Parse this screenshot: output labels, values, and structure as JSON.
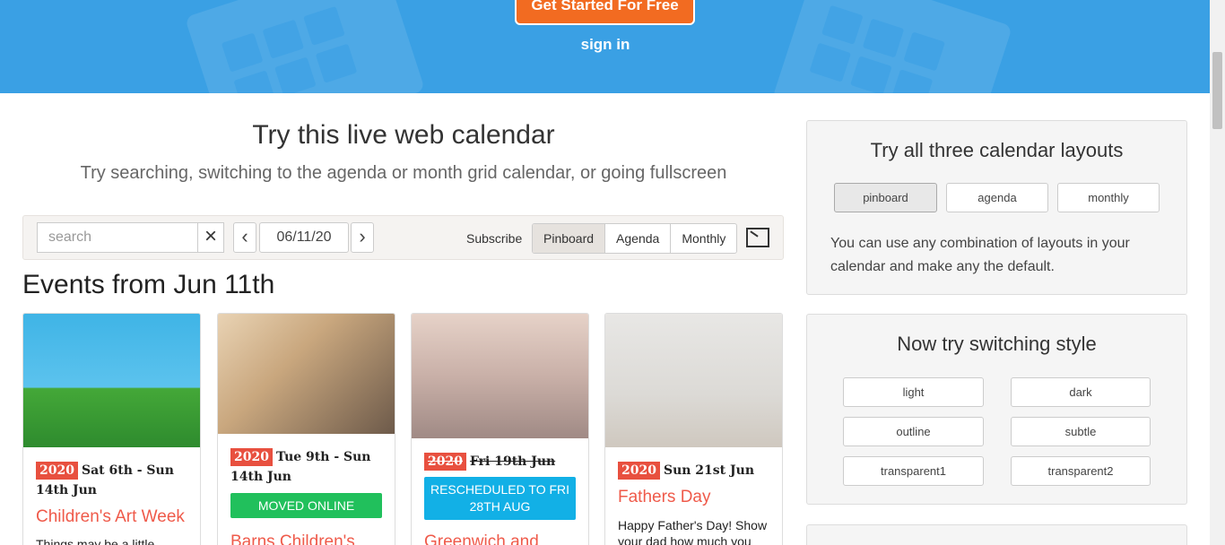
{
  "hero": {
    "cta_label": "Get Started For Free",
    "signin_label": "sign in"
  },
  "main": {
    "title": "Try this live web calendar",
    "subtitle": "Try searching, switching to the agenda or month grid calendar, or going fullscreen"
  },
  "toolbar": {
    "search_placeholder": "search",
    "clear_icon": "×",
    "prev_icon": "‹",
    "next_icon": "›",
    "date": "06/11/20",
    "subscribe_label": "Subscribe",
    "views": [
      "Pinboard",
      "Agenda",
      "Monthly"
    ],
    "selected_view": "Pinboard"
  },
  "events_title": "Events from Jun 11th",
  "events": [
    {
      "year": "2020",
      "dates": "Sat 6th - Sun 14th Jun",
      "title": "Children's Art Week",
      "description": "Things may be a little",
      "image_icon": "kids-drawing-image"
    },
    {
      "year": "2020",
      "dates": "Tue 9th - Sun 14th Jun",
      "badge": "MOVED ONLINE",
      "title": "Barns Children's",
      "image_icon": "wonderland-photo"
    },
    {
      "year": "2020",
      "dates": "Fri 19th Jun",
      "badge": "RESCHEDULED TO FRI 28TH AUG",
      "title": "Greenwich and",
      "image_icon": "circus-photo"
    },
    {
      "year": "2020",
      "dates": "Sun 21st Jun",
      "title": "Fathers Day",
      "description": "Happy Father's Day! Show your dad how much you",
      "image_icon": "father-son-beach-photo"
    }
  ],
  "layouts_panel": {
    "title": "Try all three calendar layouts",
    "buttons": [
      "pinboard",
      "agenda",
      "monthly"
    ],
    "active": "pinboard",
    "text": "You can use any combination of layouts in your calendar and make any the default."
  },
  "style_panel": {
    "title": "Now try switching style",
    "buttons": [
      "light",
      "dark",
      "outline",
      "subtle",
      "transparent1",
      "transparent2"
    ]
  },
  "colors": {
    "hero": "#3aa0e4",
    "cta": "#f26b21",
    "year_badge": "#e8503f",
    "event_title": "#ef5a4a",
    "moved_online": "#21c05c",
    "rescheduled": "#12b0e6"
  }
}
